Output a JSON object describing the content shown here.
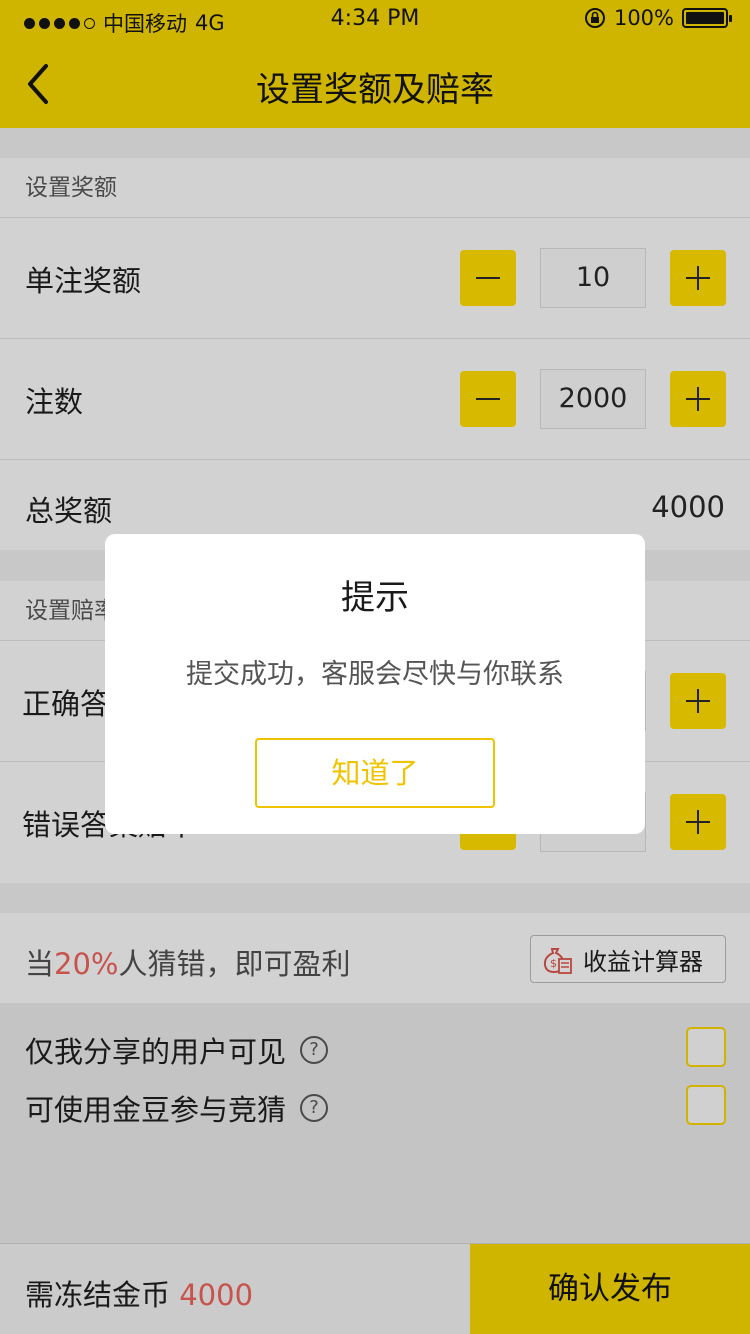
{
  "status_bar": {
    "carrier": "中国移动",
    "network": "4G",
    "time": "4:34 PM",
    "battery": "100%"
  },
  "nav": {
    "title": "设置奖额及赔率",
    "back_icon": "chevron-left-icon"
  },
  "prize_section": {
    "header": "设置奖额",
    "rows": [
      {
        "label": "单注奖额",
        "value": "10"
      },
      {
        "label": "注数",
        "value": "2000"
      }
    ],
    "total_label": "总奖额",
    "total_value": "4000"
  },
  "odds_section": {
    "header": "设置赔率",
    "rows": [
      {
        "label": "正确答案赔率"
      },
      {
        "label": "错误答案赔率"
      }
    ]
  },
  "profit": {
    "prefix": "当",
    "percent": "20%",
    "suffix": "人猜错，即可盈利",
    "calc_button": "收益计算器",
    "calc_icon": "money-bag-calculator-icon"
  },
  "options": [
    {
      "label": "仅我分享的用户可见",
      "checked": false
    },
    {
      "label": "可使用金豆参与竞猜",
      "checked": false
    }
  ],
  "bottom_bar": {
    "freeze_label": "需冻结金币",
    "freeze_amount": "4000",
    "confirm_button": "确认发布"
  },
  "modal": {
    "title": "提示",
    "message": "提交成功，客服会尽快与你联系",
    "button": "知道了"
  },
  "colors": {
    "accent": "#f0c300",
    "accent_dimmed": "#d0b500",
    "highlight_red": "#c8524c"
  }
}
